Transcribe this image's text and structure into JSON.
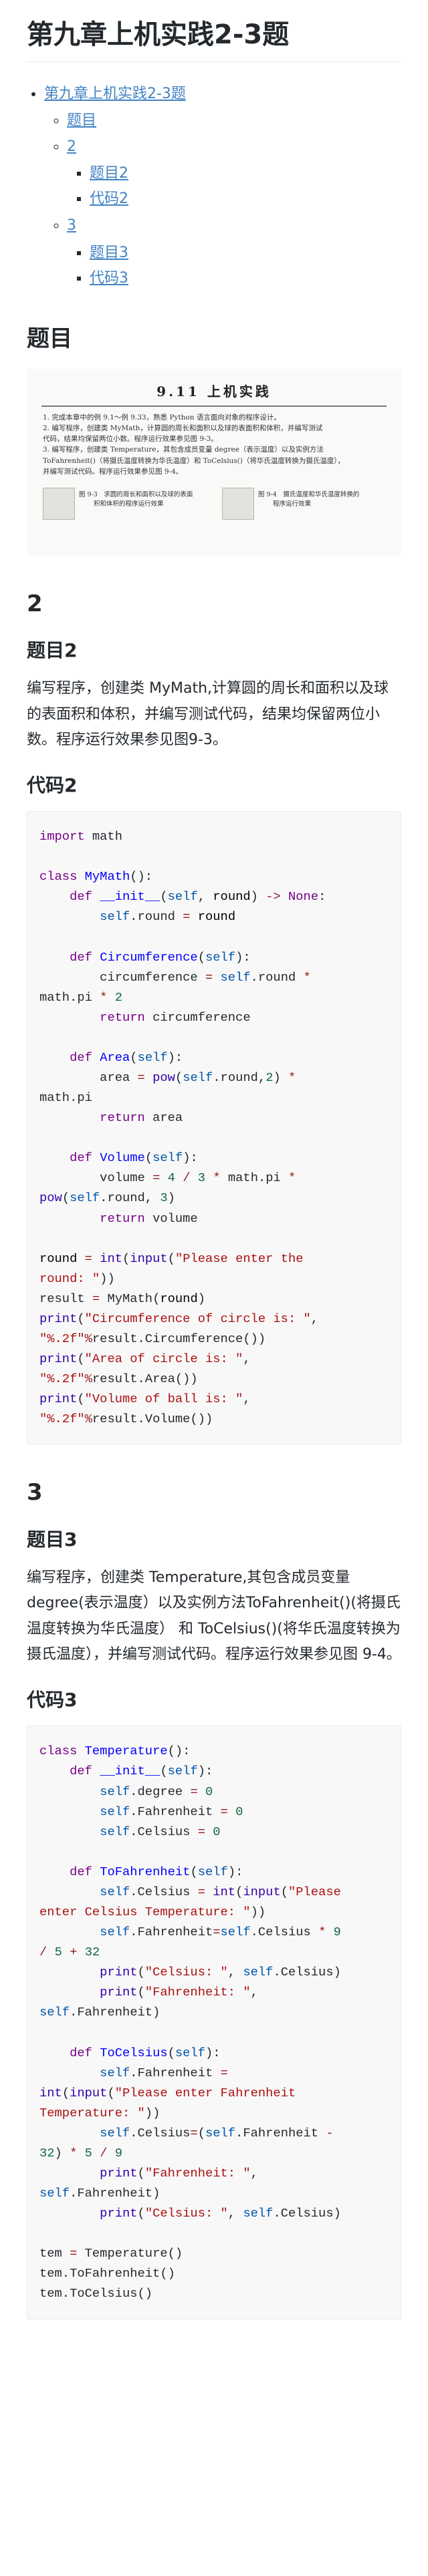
{
  "title": "第九章上机实践2-3题",
  "toc": [
    {
      "label": "第九章上机实践2-3题",
      "children": [
        {
          "label": "题目",
          "children": []
        },
        {
          "label": "2",
          "children": [
            {
              "label": "题目2"
            },
            {
              "label": "代码2"
            }
          ]
        },
        {
          "label": "3",
          "children": [
            {
              "label": "题目3"
            },
            {
              "label": "代码3"
            }
          ]
        }
      ]
    }
  ],
  "section_tm": {
    "heading": "题目"
  },
  "figure": {
    "title": "9.11  上机实践",
    "lines": [
      "1. 完成本章中的例 9.1～例 9.33，熟悉 Python 语言面向对象的程序设计。",
      "2. 编写程序，创建类 MyMath，计算圆的周长和面积以及球的表面积和体积，并编写测试",
      "代码，结果均保留两位小数。程序运行效果参见图 9-3。",
      "3. 编写程序，创建类 Temperature，其包含成员变量 degree（表示温度）以及实例方法",
      "ToFahrenheit()（将摄氏温度转换为华氏温度）和 ToCelsius()（将华氏温度转换为摄氏温度），",
      "并编写测试代码。程序运行效果参见图 9-4。"
    ],
    "caption_left_1": "图 9-3　求圆的周长和面积以及球的表面",
    "caption_left_2": "积和体积的程序运行效果",
    "caption_right_1": "图 9-4　摄氏温度和华氏温度转换的",
    "caption_right_2": "程序运行效果"
  },
  "section2": {
    "heading": "2",
    "sub1": "题目2",
    "desc": "编写程序，创建类 MyMath,计算圆的周长和面积以及球的表面积和体积，并编写测试代码，结果均保留两位小数。程序运行效果参见图9-3。",
    "sub2": "代码2"
  },
  "code2": [
    [
      [
        "kw",
        "import"
      ],
      [
        "",
        "​ math"
      ]
    ],
    [],
    [
      [
        "kw",
        "class"
      ],
      [
        "",
        " "
      ],
      [
        "def",
        "MyMath"
      ],
      [
        "",
        "():"
      ]
    ],
    [
      [
        "",
        "    "
      ],
      [
        "kw",
        "def"
      ],
      [
        "",
        " "
      ],
      [
        "def",
        "__init__"
      ],
      [
        "",
        "("
      ],
      [
        "sf",
        "self"
      ],
      [
        "",
        ", "
      ],
      [
        "var",
        "round"
      ],
      [
        "",
        ") "
      ],
      [
        "op",
        "->"
      ],
      [
        "",
        " "
      ],
      [
        "kw",
        "None"
      ],
      [
        "",
        ":"
      ]
    ],
    [
      [
        "",
        "        "
      ],
      [
        "sf",
        "self"
      ],
      [
        "",
        ".round "
      ],
      [
        "op",
        "="
      ],
      [
        "",
        " "
      ],
      [
        "var",
        "round"
      ]
    ],
    [],
    [
      [
        "",
        "    "
      ],
      [
        "kw",
        "def"
      ],
      [
        "",
        " "
      ],
      [
        "def",
        "Circumference"
      ],
      [
        "",
        "("
      ],
      [
        "sf",
        "self"
      ],
      [
        "",
        "):"
      ]
    ],
    [
      [
        "",
        "        circumference "
      ],
      [
        "op",
        "="
      ],
      [
        "",
        " "
      ],
      [
        "sf",
        "self"
      ],
      [
        "",
        ".round "
      ],
      [
        "op",
        "*"
      ],
      [
        "",
        ""
      ]
    ],
    [
      [
        "",
        "math.pi "
      ],
      [
        "op",
        "*"
      ],
      [
        "",
        " "
      ],
      [
        "num",
        "2"
      ]
    ],
    [
      [
        "",
        "        "
      ],
      [
        "kw",
        "return"
      ],
      [
        "",
        " circumference"
      ]
    ],
    [],
    [
      [
        "",
        "    "
      ],
      [
        "kw",
        "def"
      ],
      [
        "",
        " "
      ],
      [
        "def",
        "Area"
      ],
      [
        "",
        "("
      ],
      [
        "sf",
        "self"
      ],
      [
        "",
        "):"
      ]
    ],
    [
      [
        "",
        "        area "
      ],
      [
        "op",
        "="
      ],
      [
        "",
        " "
      ],
      [
        "bi",
        "pow"
      ],
      [
        "",
        "("
      ],
      [
        "sf",
        "self"
      ],
      [
        "",
        ".round,"
      ],
      [
        "num",
        "2"
      ],
      [
        "",
        ") "
      ],
      [
        "op",
        "*"
      ]
    ],
    [
      [
        "",
        "math.pi"
      ]
    ],
    [
      [
        "",
        "        "
      ],
      [
        "kw",
        "return"
      ],
      [
        "",
        " area"
      ]
    ],
    [],
    [
      [
        "",
        "    "
      ],
      [
        "kw",
        "def"
      ],
      [
        "",
        " "
      ],
      [
        "def",
        "Volume"
      ],
      [
        "",
        "("
      ],
      [
        "sf",
        "self"
      ],
      [
        "",
        "):"
      ]
    ],
    [
      [
        "",
        "        volume "
      ],
      [
        "op",
        "="
      ],
      [
        "",
        " "
      ],
      [
        "num",
        "4"
      ],
      [
        "",
        " "
      ],
      [
        "op",
        "/"
      ],
      [
        "",
        " "
      ],
      [
        "num",
        "3"
      ],
      [
        "",
        " "
      ],
      [
        "op",
        "*"
      ],
      [
        "",
        " math.pi "
      ],
      [
        "op",
        "*"
      ]
    ],
    [
      [
        "bi",
        "pow"
      ],
      [
        "",
        "("
      ],
      [
        "sf",
        "self"
      ],
      [
        "",
        ".round, "
      ],
      [
        "num",
        "3"
      ],
      [
        "",
        ")"
      ]
    ],
    [
      [
        "",
        "        "
      ],
      [
        "kw",
        "return"
      ],
      [
        "",
        " volume"
      ]
    ],
    [],
    [
      [
        "var",
        "round"
      ],
      [
        "",
        " "
      ],
      [
        "op",
        "="
      ],
      [
        "",
        " "
      ],
      [
        "bi",
        "int"
      ],
      [
        "",
        "("
      ],
      [
        "bi",
        "input"
      ],
      [
        "",
        "("
      ],
      [
        "str",
        "\"Please enter the"
      ]
    ],
    [
      [
        "str",
        "round: \""
      ],
      [
        "",
        "))"
      ]
    ],
    [
      [
        "",
        "result "
      ],
      [
        "op",
        "="
      ],
      [
        "",
        " MyMath("
      ],
      [
        "var",
        "round"
      ],
      [
        "",
        ")"
      ]
    ],
    [
      [
        "bi",
        "print"
      ],
      [
        "",
        "("
      ],
      [
        "str",
        "\"Circumference of circle is: \""
      ],
      [
        "",
        ","
      ]
    ],
    [
      [
        "str",
        "\"%.2f\""
      ],
      [
        "op",
        "%"
      ],
      [
        "",
        "result.Circumference())"
      ]
    ],
    [
      [
        "bi",
        "print"
      ],
      [
        "",
        "("
      ],
      [
        "str",
        "\"Area of circle is: \""
      ],
      [
        "",
        ","
      ]
    ],
    [
      [
        "str",
        "\"%.2f\""
      ],
      [
        "op",
        "%"
      ],
      [
        "",
        "result.Area())"
      ]
    ],
    [
      [
        "bi",
        "print"
      ],
      [
        "",
        "("
      ],
      [
        "str",
        "\"Volume of ball is: \""
      ],
      [
        "",
        ","
      ]
    ],
    [
      [
        "str",
        "\"%.2f\""
      ],
      [
        "op",
        "%"
      ],
      [
        "",
        "result.Volume())"
      ]
    ]
  ],
  "section3": {
    "heading": "3",
    "sub1": "题目3",
    "desc": "编写程序，创建类 Temperature,其包含成员变量degree(表示温度）以及实例方法ToFahrenheit()(将摄氏温度转换为华氏温度） 和 ToCelsius()(将华氏温度转换为摄氏温度），并编写测试代码。程序运行效果参见图 9-4。",
    "sub2": "代码3"
  },
  "code3": [
    [
      [
        "kw",
        "class"
      ],
      [
        "",
        " "
      ],
      [
        "def",
        "Temperature"
      ],
      [
        "",
        "():"
      ]
    ],
    [
      [
        "",
        "    "
      ],
      [
        "kw",
        "def"
      ],
      [
        "",
        " "
      ],
      [
        "def",
        "__init__"
      ],
      [
        "",
        "("
      ],
      [
        "sf",
        "self"
      ],
      [
        "",
        "):"
      ]
    ],
    [
      [
        "",
        "        "
      ],
      [
        "sf",
        "self"
      ],
      [
        "",
        ".degree "
      ],
      [
        "op",
        "="
      ],
      [
        "",
        " "
      ],
      [
        "num",
        "0"
      ]
    ],
    [
      [
        "",
        "        "
      ],
      [
        "sf",
        "self"
      ],
      [
        "",
        ".Fahrenheit "
      ],
      [
        "op",
        "="
      ],
      [
        "",
        " "
      ],
      [
        "num",
        "0"
      ]
    ],
    [
      [
        "",
        "        "
      ],
      [
        "sf",
        "self"
      ],
      [
        "",
        ".Celsius "
      ],
      [
        "op",
        "="
      ],
      [
        "",
        " "
      ],
      [
        "num",
        "0"
      ]
    ],
    [],
    [
      [
        "",
        "    "
      ],
      [
        "kw",
        "def"
      ],
      [
        "",
        " "
      ],
      [
        "def",
        "ToFahrenheit"
      ],
      [
        "",
        "("
      ],
      [
        "sf",
        "self"
      ],
      [
        "",
        "):"
      ]
    ],
    [
      [
        "",
        "        "
      ],
      [
        "sf",
        "self"
      ],
      [
        "",
        ".Celsius "
      ],
      [
        "op",
        "="
      ],
      [
        "",
        " "
      ],
      [
        "bi",
        "int"
      ],
      [
        "",
        "("
      ],
      [
        "bi",
        "input"
      ],
      [
        "",
        "("
      ],
      [
        "str",
        "\"Please"
      ]
    ],
    [
      [
        "str",
        "enter Celsius Temperature: \""
      ],
      [
        "",
        "))"
      ]
    ],
    [
      [
        "",
        "        "
      ],
      [
        "sf",
        "self"
      ],
      [
        "",
        ".Fahrenheit"
      ],
      [
        "op",
        "="
      ],
      [
        "sf",
        "self"
      ],
      [
        "",
        ".Celsius "
      ],
      [
        "op",
        "*"
      ],
      [
        "",
        " "
      ],
      [
        "num",
        "9"
      ]
    ],
    [
      [
        "op",
        "/"
      ],
      [
        "",
        " "
      ],
      [
        "num",
        "5"
      ],
      [
        "",
        " "
      ],
      [
        "op",
        "+"
      ],
      [
        "",
        " "
      ],
      [
        "num",
        "32"
      ]
    ],
    [
      [
        "",
        "        "
      ],
      [
        "bi",
        "print"
      ],
      [
        "",
        "("
      ],
      [
        "str",
        "\"Celsius: \""
      ],
      [
        "",
        ", "
      ],
      [
        "sf",
        "self"
      ],
      [
        "",
        ".Celsius)"
      ]
    ],
    [
      [
        "",
        "        "
      ],
      [
        "bi",
        "print"
      ],
      [
        "",
        "("
      ],
      [
        "str",
        "\"Fahrenheit: \""
      ],
      [
        "",
        ","
      ]
    ],
    [
      [
        "sf",
        "self"
      ],
      [
        "",
        ".Fahrenheit)"
      ]
    ],
    [],
    [
      [
        "",
        "    "
      ],
      [
        "kw",
        "def"
      ],
      [
        "",
        " "
      ],
      [
        "def",
        "ToCelsius"
      ],
      [
        "",
        "("
      ],
      [
        "sf",
        "self"
      ],
      [
        "",
        "):"
      ]
    ],
    [
      [
        "",
        "        "
      ],
      [
        "sf",
        "self"
      ],
      [
        "",
        ".Fahrenheit "
      ],
      [
        "op",
        "="
      ]
    ],
    [
      [
        "bi",
        "int"
      ],
      [
        "",
        "("
      ],
      [
        "bi",
        "input"
      ],
      [
        "",
        "("
      ],
      [
        "str",
        "\"Please enter Fahrenheit"
      ]
    ],
    [
      [
        "str",
        "Temperature: \""
      ],
      [
        "",
        "))"
      ]
    ],
    [
      [
        "",
        "        "
      ],
      [
        "sf",
        "self"
      ],
      [
        "",
        ".Celsius"
      ],
      [
        "op",
        "="
      ],
      [
        "",
        "("
      ],
      [
        "sf",
        "self"
      ],
      [
        "",
        ".Fahrenheit "
      ],
      [
        "op",
        "-"
      ]
    ],
    [
      [
        "num",
        "32"
      ],
      [
        "",
        ") "
      ],
      [
        "op",
        "*"
      ],
      [
        "",
        " "
      ],
      [
        "num",
        "5"
      ],
      [
        "",
        " "
      ],
      [
        "op",
        "/"
      ],
      [
        "",
        " "
      ],
      [
        "num",
        "9"
      ]
    ],
    [
      [
        "",
        "        "
      ],
      [
        "bi",
        "print"
      ],
      [
        "",
        "("
      ],
      [
        "str",
        "\"Fahrenheit: \""
      ],
      [
        "",
        ","
      ]
    ],
    [
      [
        "sf",
        "self"
      ],
      [
        "",
        ".Fahrenheit)"
      ]
    ],
    [
      [
        "",
        "        "
      ],
      [
        "bi",
        "print"
      ],
      [
        "",
        "("
      ],
      [
        "str",
        "\"Celsius: \""
      ],
      [
        "",
        ", "
      ],
      [
        "sf",
        "self"
      ],
      [
        "",
        ".Celsius)"
      ]
    ],
    [],
    [
      [
        "",
        "tem "
      ],
      [
        "op",
        "="
      ],
      [
        "",
        " Temperature()"
      ]
    ],
    [
      [
        "",
        "tem.ToFahrenheit()"
      ]
    ],
    [
      [
        "",
        "tem.ToCelsius()"
      ]
    ]
  ]
}
